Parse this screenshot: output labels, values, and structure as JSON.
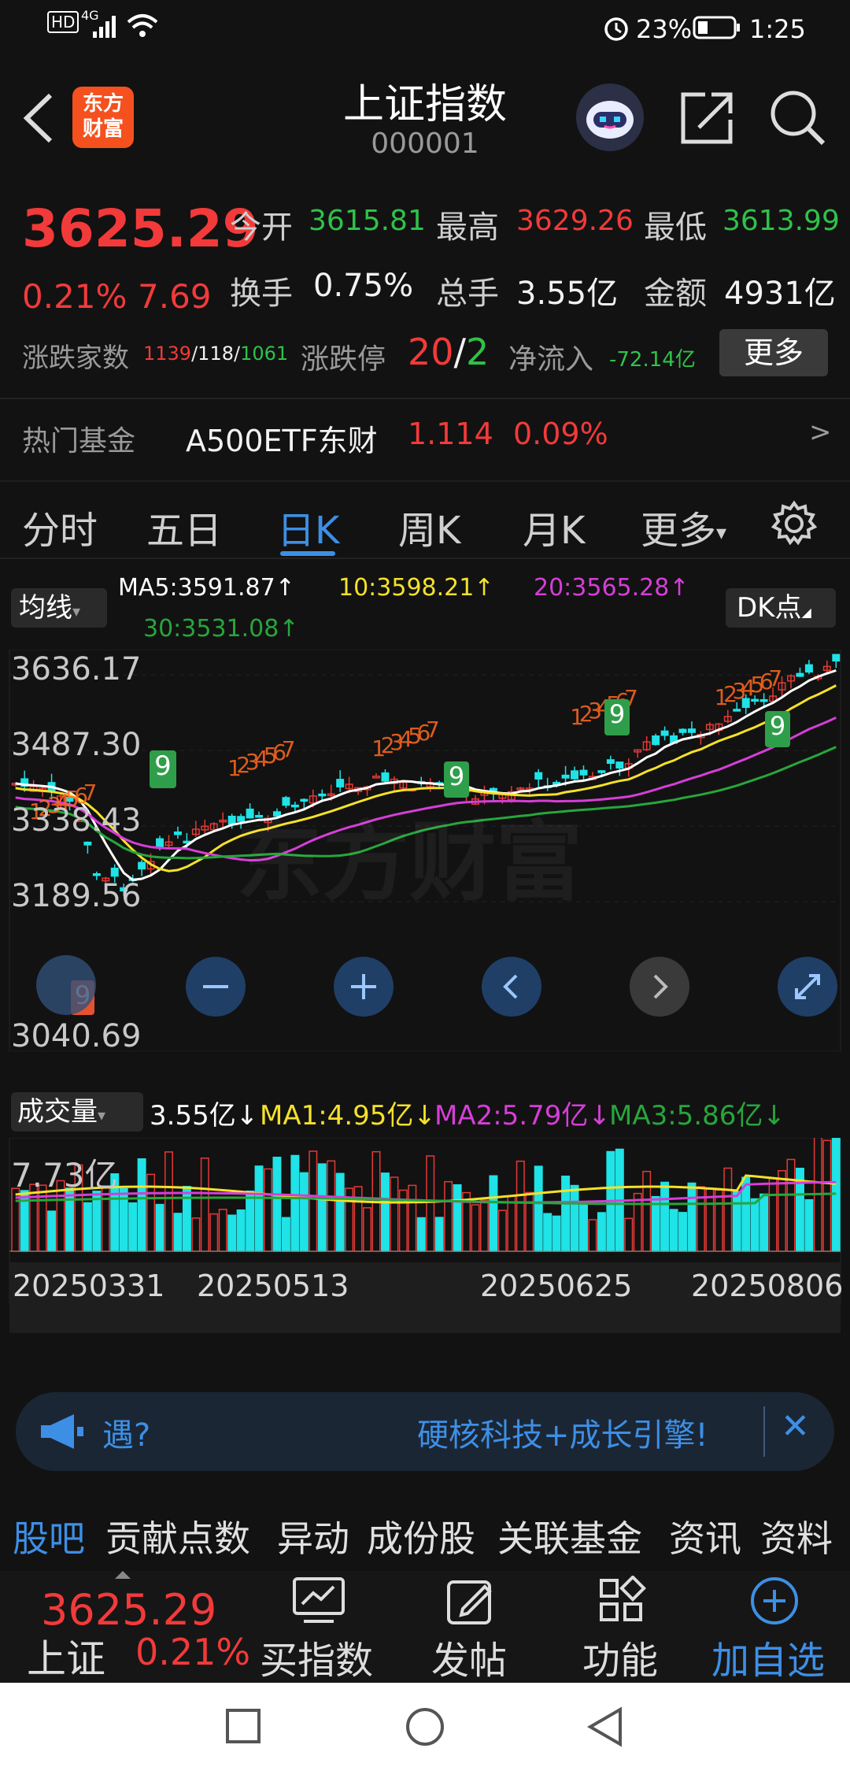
{
  "status": {
    "hd": "HD",
    "net": "4G",
    "battery": "23%",
    "time": "1:25"
  },
  "header": {
    "title": "上证指数",
    "code": "000001",
    "logo_line1": "东方",
    "logo_line2": "财富"
  },
  "quote": {
    "price": "3625.29",
    "pct": "0.21%",
    "chg": "7.69",
    "open_label": "今开",
    "open": "3615.81",
    "high_label": "最高",
    "high": "3629.26",
    "low_label": "最低",
    "low": "3613.99",
    "turnover_label": "换手",
    "turnover": "0.75%",
    "vol_label": "总手",
    "vol": "3.55亿",
    "amount_label": "金额",
    "amount": "4931亿",
    "breadth_label": "涨跌家数",
    "up": "1139",
    "sep1": "/",
    "flat": "118",
    "sep2": "/",
    "down": "1061",
    "limit_label": "涨跌停",
    "limit_up": "20",
    "sep3": "/",
    "limit_down": "2",
    "inflow_label": "净流入",
    "inflow": "-72.14亿",
    "more_button": "更多"
  },
  "fund": {
    "label": "热门基金",
    "name": "A500ETF东财",
    "price": "1.114",
    "pct": "0.09%",
    "arrow": ">"
  },
  "tabs": {
    "t1": "分时",
    "t2": "五日",
    "t3": "日K",
    "t4": "周K",
    "t5": "月K",
    "t6": "更多",
    "t6_caret": "▾"
  },
  "chart": {
    "ma_selector": "均线",
    "ma_caret": "▾",
    "ma5": "MA5:3591.87↑",
    "ma10": "10:3598.21↑",
    "ma20": "20:3565.28↑",
    "ma30": "30:3531.08↑",
    "dk_button": "DK点",
    "dk_caret": "◢",
    "y1": "3636.17",
    "y2": "3487.30",
    "y3": "3338.43",
    "y4": "3189.56",
    "y5": "3040.69",
    "watermark": "东方财富",
    "nine_a": "9",
    "nine_b": "9",
    "nine_c": "9",
    "nine_d": "9",
    "nine_e": "9",
    "vol_selector": "成交量",
    "vol_caret": "▾",
    "vol_value": "3.55亿↓",
    "vol_ma1": "MA1:4.95亿↓",
    "vol_ma2": "MA2:5.79亿↓",
    "vol_ma3": "MA3:5.86亿↓",
    "vol_axis": "7.73亿",
    "dates": [
      "20250331",
      "20250513",
      "20250625",
      "20250806"
    ],
    "colors": {
      "up": "#e53935",
      "down": "#1fe3e6",
      "ma5": "#ffffff",
      "ma10": "#f5e12a",
      "ma20": "#d63ed8",
      "ma30": "#27a63c"
    }
  },
  "banner": {
    "text_left": "遇?",
    "text_right": "硬核科技+成长引擎!",
    "close": "✕"
  },
  "bottomtabs": {
    "b1": "股吧",
    "b2": "贡献点数",
    "b3": "异动",
    "b4": "成份股",
    "b5": "关联基金",
    "b6": "资讯",
    "b7": "资料"
  },
  "dock": {
    "price": "3625.29",
    "name": "上证",
    "pct": "0.21%",
    "buy": "买指数",
    "post": "发帖",
    "func": "功能",
    "add": "加自选"
  }
}
